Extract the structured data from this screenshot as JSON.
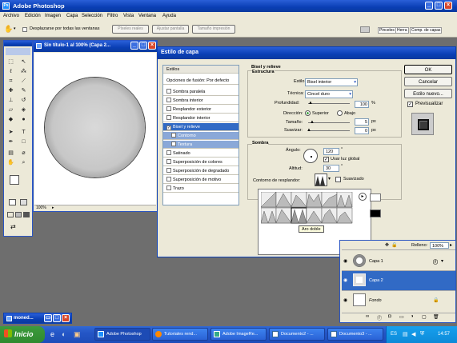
{
  "app": {
    "title": "Adobe Photoshop"
  },
  "menu": [
    "Archivo",
    "Edición",
    "Imagen",
    "Capa",
    "Selección",
    "Filtro",
    "Vista",
    "Ventana",
    "Ayuda"
  ],
  "options_bar": {
    "checkbox_label": "Desplazarse por todas las ventanas",
    "btn_real": "Píxeles reales",
    "btn_fit": "Ajustar pantalla",
    "btn_print": "Tamaño impresión",
    "tabs": [
      "Pinceles",
      "Herra",
      "Comp. de capas"
    ]
  },
  "document": {
    "title": "Sin título-1 al 100% (Capa 2...",
    "zoom": "100%"
  },
  "minimized": {
    "label": "moned..."
  },
  "dialog": {
    "title": "Estilo de capa",
    "styles_header": "Estilos",
    "blend_options": "Opciones de fusión: Por defecto",
    "styles": [
      {
        "label": "Sombra paralela",
        "state": ""
      },
      {
        "label": "Sombra interior",
        "state": ""
      },
      {
        "label": "Resplandor exterior",
        "state": ""
      },
      {
        "label": "Resplandor interior",
        "state": ""
      },
      {
        "label": "Bisel y relieve",
        "state": "sel"
      },
      {
        "label": "Contorno",
        "state": "sub"
      },
      {
        "label": "Textura",
        "state": "sub"
      },
      {
        "label": "Satinado",
        "state": ""
      },
      {
        "label": "Superposición de colores",
        "state": ""
      },
      {
        "label": "Superposición de degradado",
        "state": ""
      },
      {
        "label": "Superposición de motivo",
        "state": ""
      },
      {
        "label": "Trazo",
        "state": ""
      }
    ],
    "bevel": {
      "section": "Bisel y relieve",
      "structure": "Estructura",
      "style_label": "Estilo:",
      "style_value": "Bisel interior",
      "technique_label": "Técnica:",
      "technique_value": "Cincel duro",
      "depth_label": "Profundidad:",
      "depth_value": "100",
      "depth_unit": "%",
      "direction_label": "Dirección:",
      "dir_up": "Superior",
      "dir_down": "Abajo",
      "size_label": "Tamaño:",
      "size_value": "5",
      "size_unit": "px",
      "soften_label": "Suavizar:",
      "soften_value": "0",
      "soften_unit": "px"
    },
    "shading": {
      "section": "Sombra",
      "angle_label": "Ángulo:",
      "angle_value": "120",
      "angle_unit": "°",
      "global_light": "Usar luz global",
      "altitude_label": "Altitud:",
      "altitude_value": "30",
      "altitude_unit": "°",
      "gloss_label": "Contorno de resplandor:",
      "antialias": "Suavizado",
      "tooltip": "Aro doble"
    },
    "buttons": {
      "ok": "OK",
      "cancel": "Cancelar",
      "new_style": "Estilo nuevo...",
      "preview": "Previsualizar"
    }
  },
  "layers": {
    "fill_label": "Relleno:",
    "fill_value": "100%",
    "items": [
      {
        "name": "Capa 1",
        "selected": false
      },
      {
        "name": "Capa 2",
        "selected": true
      },
      {
        "name": "Fondo",
        "selected": false
      }
    ]
  },
  "taskbar": {
    "start": "Inicio",
    "tasks": [
      "Adobe Photoshop",
      "Tutoriales rend...",
      "Adobe ImageRe...",
      "Documento2 - ...",
      "Documento3 - ..."
    ],
    "lang": "ES",
    "clock": "14:57"
  }
}
